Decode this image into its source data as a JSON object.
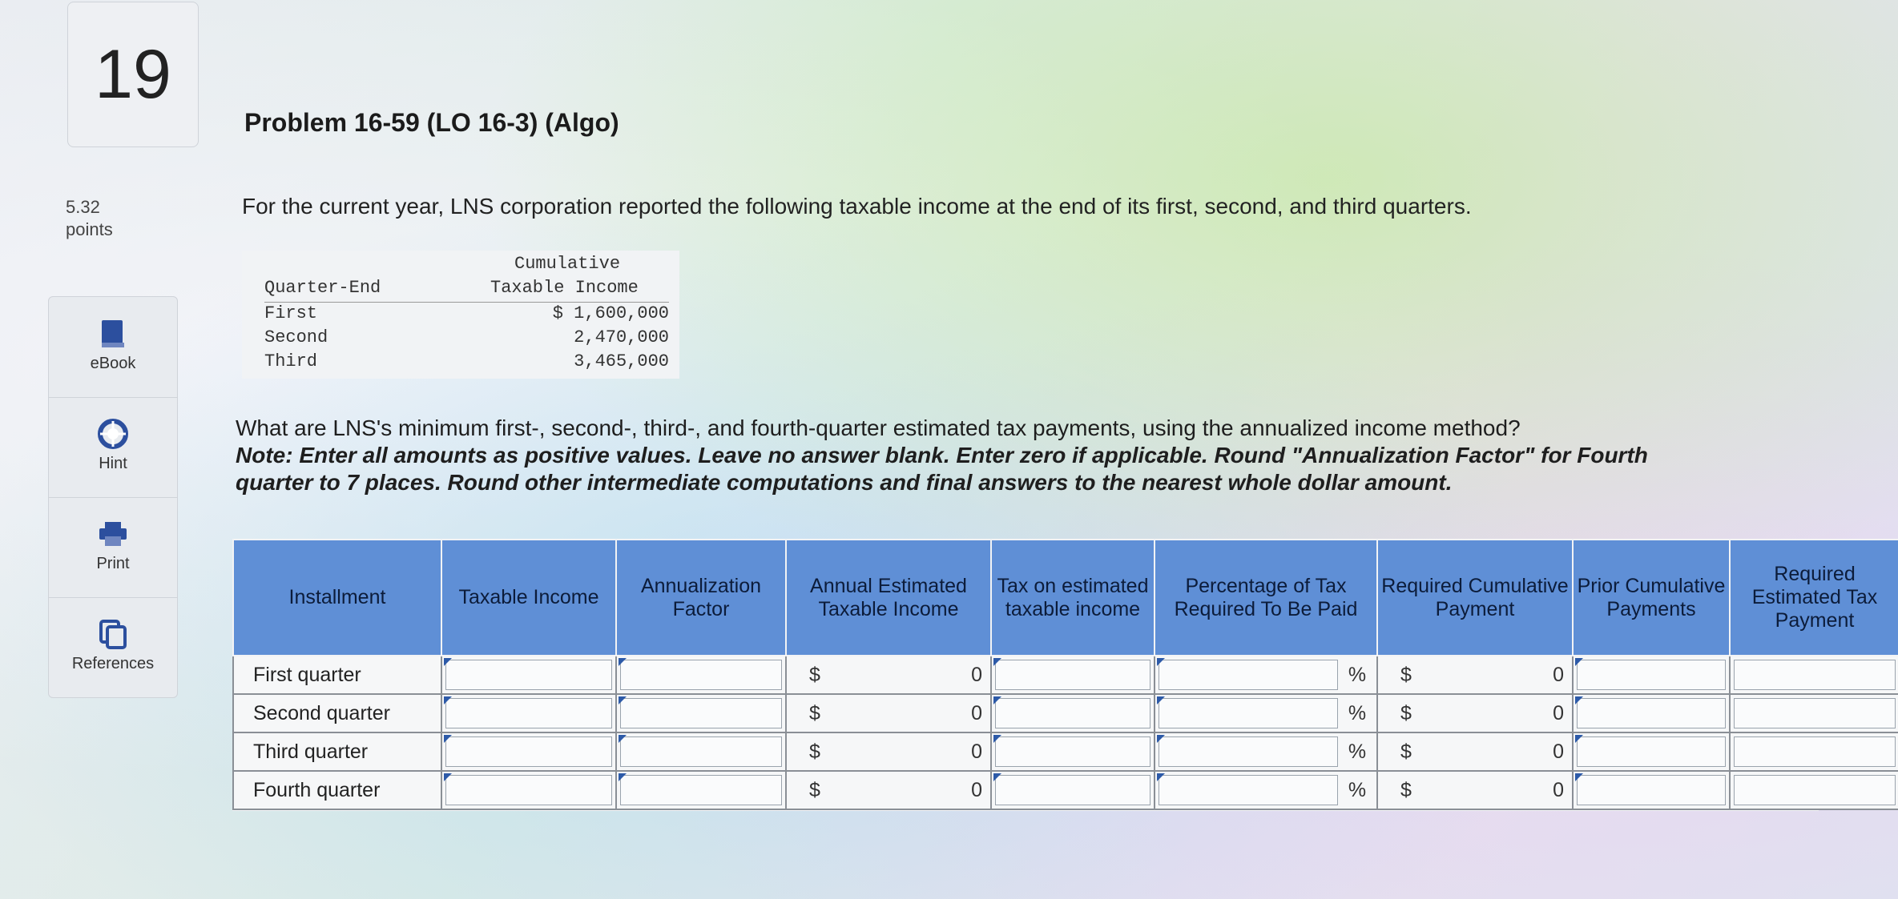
{
  "question_number": "19",
  "points": {
    "value": "5.32",
    "label": "points"
  },
  "sidebar": {
    "items": [
      {
        "label": "eBook",
        "icon": "book-icon"
      },
      {
        "label": "Hint",
        "icon": "lifebuoy-icon"
      },
      {
        "label": "Print",
        "icon": "printer-icon"
      },
      {
        "label": "References",
        "icon": "copy-icon"
      }
    ]
  },
  "problem": {
    "title": "Problem 16-59 (LO 16-3) (Algo)",
    "intro": "For the current year, LNS corporation reported the following taxable income at the end of its first, second, and third quarters."
  },
  "quarter_table": {
    "header_col1": "Quarter-End",
    "header_col2_line1": "Cumulative",
    "header_col2_line2": "Taxable Income",
    "rows": [
      {
        "quarter": "First",
        "income": "$ 1,600,000"
      },
      {
        "quarter": "Second",
        "income": "2,470,000"
      },
      {
        "quarter": "Third",
        "income": "3,465,000"
      }
    ]
  },
  "question": {
    "text": "What are LNS's minimum first-, second-, third-, and fourth-quarter estimated tax payments, using the annualized income method?",
    "note": "Note: Enter all amounts as positive values. Leave no answer blank. Enter zero if applicable. Round \"Annualization Factor\" for Fourth quarter to 7 places. Round other intermediate computations and final answers to the nearest whole dollar amount."
  },
  "answer_table": {
    "headers": [
      "Installment",
      "Taxable Income",
      "Annualization Factor",
      "Annual Estimated Taxable Income",
      "Tax on estimated taxable income",
      "Percentage of Tax Required To Be Paid",
      "Required Cumulative Payment",
      "Prior Cumulative Payments",
      "Required Estimated Tax Payment"
    ],
    "rows": [
      {
        "installment": "First quarter",
        "currency": "$",
        "annual_value": "0",
        "pct_symbol": "%",
        "req_currency": "$",
        "req_value": "0"
      },
      {
        "installment": "Second quarter",
        "currency": "$",
        "annual_value": "0",
        "pct_symbol": "%",
        "req_currency": "$",
        "req_value": "0"
      },
      {
        "installment": "Third quarter",
        "currency": "$",
        "annual_value": "0",
        "pct_symbol": "%",
        "req_currency": "$",
        "req_value": "0"
      },
      {
        "installment": "Fourth quarter",
        "currency": "$",
        "annual_value": "0",
        "pct_symbol": "%",
        "req_currency": "$",
        "req_value": "0"
      }
    ]
  },
  "colors": {
    "header_blue": "#5f8fd6",
    "text": "#1e1e1e"
  }
}
